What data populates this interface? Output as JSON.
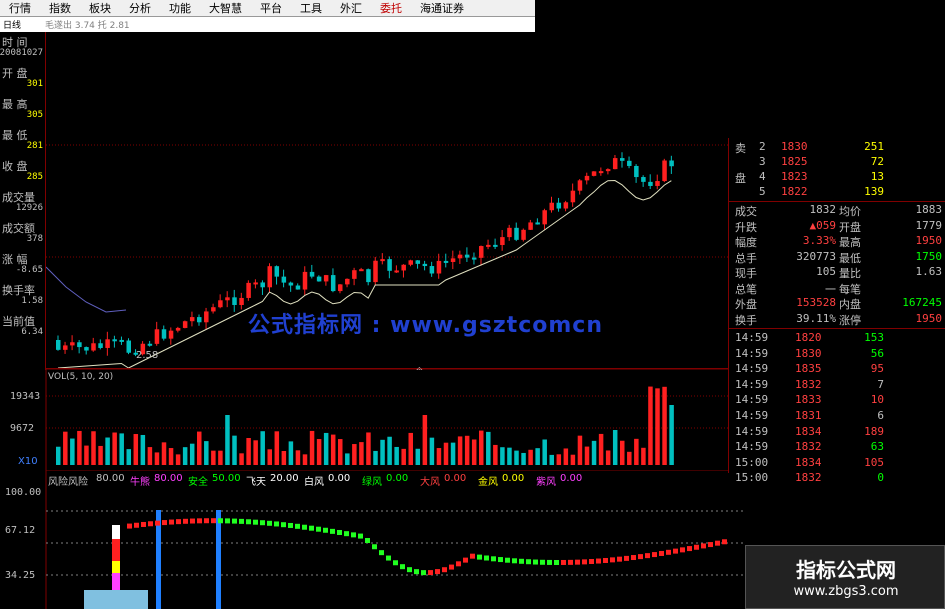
{
  "menu": [
    "行情",
    "指数",
    "板块",
    "分析",
    "功能",
    "大智慧",
    "平台",
    "工具",
    "外汇",
    "委托",
    "海通证券"
  ],
  "menu_active": "委托",
  "subbar": {
    "period": "日线",
    "label": "毛遂出 3.74 托 2.81"
  },
  "left_panel": [
    {
      "label": "时 间",
      "value": "20081027",
      "color": "#c0c0c0"
    },
    {
      "label": "开 盘",
      "value": "301",
      "color": "#ffff00"
    },
    {
      "label": "最 高",
      "value": "305",
      "color": "#ffff00"
    },
    {
      "label": "最 低",
      "value": "281",
      "color": "#ffff00"
    },
    {
      "label": "收 盘",
      "value": "285",
      "color": "#ffff00"
    },
    {
      "label": "成交量",
      "value": "12926",
      "color": "#c0c0c0"
    },
    {
      "label": "成交额",
      "value": "378",
      "color": "#c0c0c0"
    },
    {
      "label": "涨 幅",
      "value": "-8.65",
      "color": "#c0c0c0"
    },
    {
      "label": "换手率",
      "value": "1.58",
      "color": "#c0c0c0"
    },
    {
      "label": "当前值",
      "value": "6.34",
      "color": "#c0c0c0"
    }
  ],
  "main_chart": {
    "low_annotation": "2.58",
    "watermark": "公式指标网 : www.gsztcomcn"
  },
  "vol_chart": {
    "title": "VOL(5, 10, 20)",
    "ticks": [
      "19343",
      "9672"
    ],
    "unit": "X10"
  },
  "indicator": {
    "title": "风险风险",
    "params": [
      {
        "name": "牛熊",
        "value": "80.00",
        "color": "#ff40ff"
      },
      {
        "name": "安全",
        "value": "50.00",
        "color": "#00ff00"
      },
      {
        "name": "飞天",
        "value": "20.00",
        "color": "#ffffff"
      },
      {
        "name": "白风",
        "value": "0.00",
        "color": "#ffffff"
      },
      {
        "name": "绿风",
        "value": "0.00",
        "color": "#00ff00"
      },
      {
        "name": "大风",
        "value": "0.00",
        "color": "#ff4040"
      },
      {
        "name": "金风",
        "value": "0.00",
        "color": "#ffff00"
      },
      {
        "name": "紫风",
        "value": "0.00",
        "color": "#ff40ff"
      }
    ],
    "first_value": "80.00",
    "ticks": [
      "100.00",
      "67.12",
      "34.25"
    ]
  },
  "order_book": [
    {
      "side": "卖",
      "level": "2",
      "price": "1830",
      "vol": "251"
    },
    {
      "side": "",
      "level": "3",
      "price": "1825",
      "vol": "72"
    },
    {
      "side": "盘",
      "level": "4",
      "price": "1823",
      "vol": "13"
    },
    {
      "side": "",
      "level": "5",
      "price": "1822",
      "vol": "139"
    }
  ],
  "quote_stats": [
    {
      "l1": "成交",
      "v1": "1832",
      "l2": "均价",
      "v2": "1883",
      "c1": "#c0c0c0",
      "c2": "#c0c0c0"
    },
    {
      "l1": "升跌",
      "v1": "▲059",
      "l2": "开盘",
      "v2": "1779",
      "c1": "#ff4040",
      "c2": "#c0c0c0"
    },
    {
      "l1": "幅度",
      "v1": "3.33%",
      "l2": "最高",
      "v2": "1950",
      "c1": "#ff4040",
      "c2": "#ff4040"
    },
    {
      "l1": "总手",
      "v1": "320773",
      "l2": "最低",
      "v2": "1750",
      "c1": "#c0c0c0",
      "c2": "#00ff00"
    },
    {
      "l1": "现手",
      "v1": "105",
      "l2": "量比",
      "v2": "1.63",
      "c1": "#c0c0c0",
      "c2": "#c0c0c0"
    },
    {
      "l1": "总笔",
      "v1": "一",
      "l2": "每笔",
      "v2": "",
      "c1": "#c0c0c0",
      "c2": "#c0c0c0"
    },
    {
      "l1": "外盘",
      "v1": "153528",
      "l2": "内盘",
      "v2": "167245",
      "c1": "#ff4040",
      "c2": "#00ff00"
    },
    {
      "l1": "换手",
      "v1": "39.11%",
      "l2": "涨停",
      "v2": "1950",
      "c1": "#c0c0c0",
      "c2": "#ff4040"
    }
  ],
  "ticks": [
    {
      "time": "14:59",
      "price": "1820",
      "vol": "153",
      "vc": "#00ff00"
    },
    {
      "time": "14:59",
      "price": "1830",
      "vol": "56",
      "vc": "#00ff00"
    },
    {
      "time": "14:59",
      "price": "1835",
      "vol": "95",
      "vc": "#ff4040"
    },
    {
      "time": "14:59",
      "price": "1832",
      "vol": "7",
      "vc": "#c0c0c0"
    },
    {
      "time": "14:59",
      "price": "1833",
      "vol": "10",
      "vc": "#ff4040"
    },
    {
      "time": "14:59",
      "price": "1831",
      "vol": "6",
      "vc": "#c0c0c0"
    },
    {
      "time": "14:59",
      "price": "1834",
      "vol": "189",
      "vc": "#ff4040"
    },
    {
      "time": "14:59",
      "price": "1832",
      "vol": "63",
      "vc": "#00ff00"
    },
    {
      "time": "15:00",
      "price": "1834",
      "vol": "105",
      "vc": "#ff4040"
    },
    {
      "time": "15:00",
      "price": "1832",
      "vol": "0",
      "vc": "#00ff00"
    }
  ],
  "brand": {
    "title": "指标公式网",
    "url": "www.zbgs3.com"
  },
  "colors": {
    "up": "#ff2020",
    "down": "#00c0c0",
    "ma": "#e0e0c0",
    "grid": "#800000"
  }
}
